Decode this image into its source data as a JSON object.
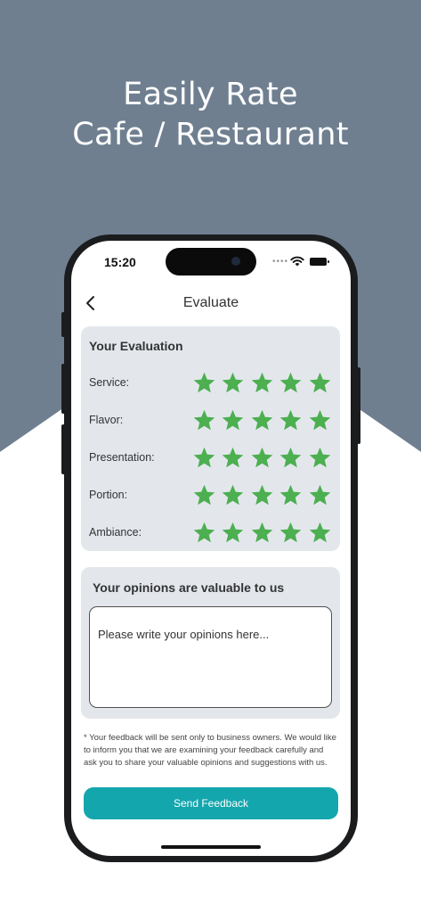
{
  "headline": {
    "line1": "Easily Rate",
    "line2": "Cafe / Restaurant"
  },
  "status_bar": {
    "time": "15:20"
  },
  "nav": {
    "title": "Evaluate"
  },
  "evaluation": {
    "title": "Your Evaluation",
    "star_color": "#4caf50",
    "max_stars": 5,
    "ratings": [
      {
        "label": "Service:",
        "stars": 5
      },
      {
        "label": "Flavor:",
        "stars": 5
      },
      {
        "label": "Presentation:",
        "stars": 5
      },
      {
        "label": "Portion:",
        "stars": 5
      },
      {
        "label": "Ambiance:",
        "stars": 5
      }
    ]
  },
  "opinion": {
    "title": "Your opinions are valuable to us",
    "placeholder": "Please write your opinions here..."
  },
  "note": "* Your feedback will be sent only to business owners. We would like to inform you that we are examining your feedback carefully and ask you to share your valuable opinions and suggestions with us.",
  "send_button": {
    "label": "Send Feedback",
    "color": "#14a6ad"
  },
  "colors": {
    "background_top": "#6f7f90",
    "card": "#e3e7ec"
  }
}
